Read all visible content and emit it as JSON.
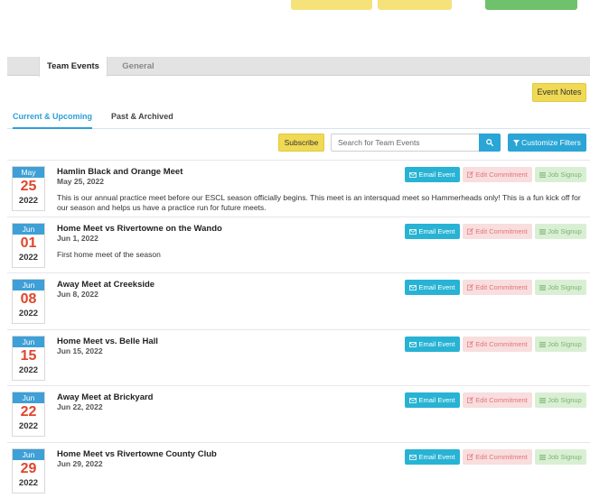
{
  "main_tabs": [
    {
      "label": "Team Events",
      "active": true
    },
    {
      "label": "General",
      "active": false
    }
  ],
  "event_notes_label": "Event Notes",
  "sub_tabs": [
    {
      "label": "Current & Upcoming",
      "active": true
    },
    {
      "label": "Past & Archived",
      "active": false
    }
  ],
  "toolbar": {
    "subscribe_label": "Subscribe",
    "search_placeholder": "Search for Team Events",
    "search_icon": "search-icon",
    "filters_label": "Customize Filters",
    "filter_icon": "filter-icon"
  },
  "actions": {
    "email_label": "Email Event",
    "commit_label": "Edit Commitment",
    "job_label": "Job Signup"
  },
  "colors": {
    "accent_blue": "#2aa5d6",
    "yellow": "#f0d954",
    "day_red": "#e0452b"
  },
  "events": [
    {
      "month": "May",
      "day": "25",
      "year": "2022",
      "title": "Hamlin Black and Orange Meet",
      "date": "May 25, 2022",
      "description": "This is our annual practice meet before our ESCL season officially begins. This meet is an intersquad meet so Hammerheads only! This is a fun kick off for our season and helps us have a practice run for future meets."
    },
    {
      "month": "Jun",
      "day": "01",
      "year": "2022",
      "title": "Home Meet vs Rivertowne on the Wando",
      "date": "Jun 1, 2022",
      "description": "First home meet of the season"
    },
    {
      "month": "Jun",
      "day": "08",
      "year": "2022",
      "title": "Away Meet at Creekside",
      "date": "Jun 8, 2022",
      "description": ""
    },
    {
      "month": "Jun",
      "day": "15",
      "year": "2022",
      "title": "Home Meet vs. Belle Hall",
      "date": "Jun 15, 2022",
      "description": ""
    },
    {
      "month": "Jun",
      "day": "22",
      "year": "2022",
      "title": "Away Meet at Brickyard",
      "date": "Jun 22, 2022",
      "description": ""
    },
    {
      "month": "Jun",
      "day": "29",
      "year": "2022",
      "title": "Home Meet vs Rivertowne County Club",
      "date": "Jun 29, 2022",
      "description": ""
    }
  ]
}
